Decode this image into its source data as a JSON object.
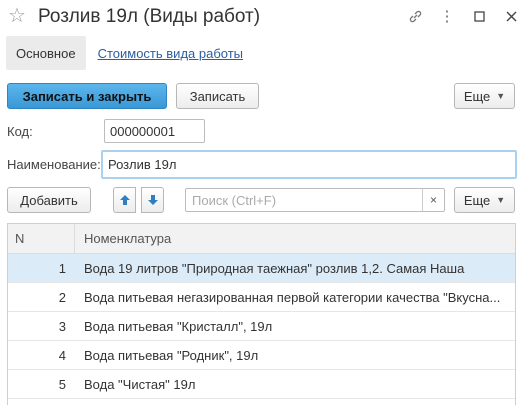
{
  "window": {
    "title": "Розлив 19л (Виды работ)"
  },
  "tabs": {
    "main": "Основное",
    "cost": "Стоимость вида работы"
  },
  "toolbar": {
    "save_close": "Записать и закрыть",
    "save": "Записать",
    "more": "Еще"
  },
  "form": {
    "code_label": "Код:",
    "code_value": "000000001",
    "name_label": "Наименование:",
    "name_value": "Розлив 19л"
  },
  "table_toolbar": {
    "add": "Добавить",
    "search_placeholder": "Поиск (Ctrl+F)",
    "clear": "×",
    "more": "Еще"
  },
  "table": {
    "columns": [
      "N",
      "Номенклатура"
    ],
    "rows": [
      {
        "n": "1",
        "name": "Вода  19 литров \"Природная таежная\" розлив 1,2. Самая Наша"
      },
      {
        "n": "2",
        "name": "Вода питьевая негазированная первой категории качества \"Вкусна..."
      },
      {
        "n": "3",
        "name": "Вода питьевая \"Кристалл\", 19л"
      },
      {
        "n": "4",
        "name": "Вода питьевая \"Родник\", 19л"
      },
      {
        "n": "5",
        "name": "Вода \"Чистая\" 19л"
      }
    ]
  },
  "colors": {
    "accent": "#3998d6",
    "link": "#2a5fa0",
    "selected_row": "#dcebf8"
  }
}
